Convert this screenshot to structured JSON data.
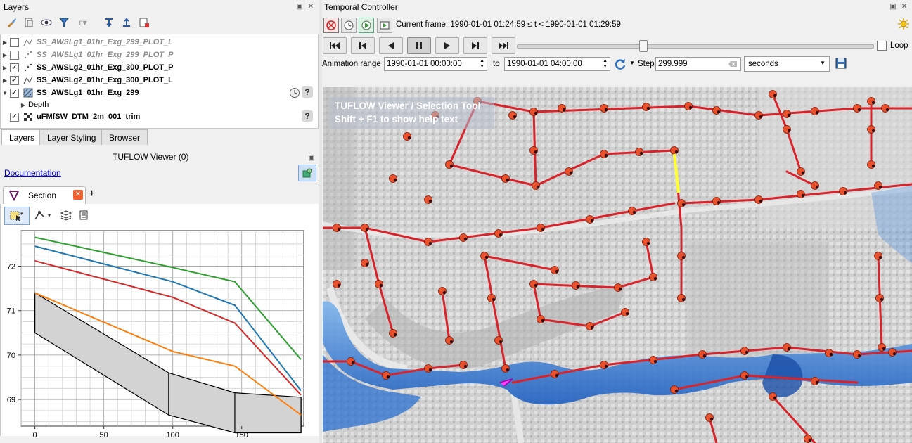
{
  "layers_panel": {
    "title": "Layers",
    "items": [
      {
        "name": "SS_AWSLg1_01hr_Exg_299_PLOT_L",
        "checked": false,
        "dim": true,
        "type": "line"
      },
      {
        "name": "SS_AWSLg1_01hr_Exg_299_PLOT_P",
        "checked": false,
        "dim": true,
        "type": "point"
      },
      {
        "name": "SS_AWSLg2_01hr_Exg_300_PLOT_P",
        "checked": true,
        "dim": false,
        "type": "point"
      },
      {
        "name": "SS_AWSLg2_01hr_Exg_300_PLOT_L",
        "checked": true,
        "dim": false,
        "type": "line"
      },
      {
        "name": "SS_AWSLg1_01hr_Exg_299",
        "checked": true,
        "dim": false,
        "type": "mesh"
      },
      {
        "name": "uFMfSW_DTM_2m_001_trim",
        "checked": true,
        "dim": false,
        "type": "raster"
      }
    ],
    "sub_item": "Depth",
    "tabs": [
      "Layers",
      "Layer Styling",
      "Browser"
    ]
  },
  "tuflow_panel": {
    "title": "TUFLOW Viewer (0)",
    "documentation_link": "Documentation",
    "section_tab": "Section",
    "add_tab": "+"
  },
  "section_chart": {
    "y_ticks": [
      "72",
      "71",
      "70",
      "69"
    ],
    "x_ticks": [
      "0",
      "50",
      "100",
      "150"
    ]
  },
  "chart_data": {
    "type": "line",
    "xlabel": "",
    "ylabel": "",
    "xlim": [
      -10,
      195
    ],
    "ylim": [
      68.4,
      72.8
    ],
    "series": [
      {
        "color": "#2ca02c",
        "x": [
          0,
          100,
          145,
          193
        ],
        "y": [
          72.65,
          71.97,
          71.65,
          69.9
        ]
      },
      {
        "color": "#1f77b4",
        "x": [
          0,
          100,
          145,
          193
        ],
        "y": [
          72.45,
          71.65,
          71.12,
          69.2
        ]
      },
      {
        "color": "#d62728",
        "x": [
          0,
          100,
          145,
          193
        ],
        "y": [
          72.12,
          71.3,
          70.72,
          69.1
        ]
      },
      {
        "color": "#ff7f0e",
        "x": [
          0,
          100,
          145,
          193
        ],
        "y": [
          71.4,
          70.08,
          69.75,
          68.65
        ]
      }
    ],
    "bed": {
      "top": {
        "x": [
          0,
          97,
          145,
          193
        ],
        "y": [
          71.4,
          69.6,
          69.15,
          69.05
        ]
      },
      "bottom": {
        "x": [
          0,
          97,
          145,
          193
        ],
        "y": [
          70.5,
          68.65,
          68.25,
          68.25
        ]
      },
      "fill": "#d3d3d3"
    },
    "grid": true
  },
  "temporal": {
    "title": "Temporal Controller",
    "current_frame": "Current frame: 1990-01-01 01:24:59 ≤ t < 1990-01-01 01:29:59",
    "loop_label": "Loop",
    "animation_range_label": "Animation range",
    "range_start": "1990-01-01 00:00:00",
    "to_label": "to",
    "range_end": "1990-01-01 04:00:00",
    "step_label": "Step",
    "step_value": "299.999",
    "step_unit": "seconds",
    "slider_fraction": 0.35
  },
  "map": {
    "overlay_line1": "TUFLOW Viewer / Selection Tool",
    "overlay_line2": "Shift + F1 to show help text"
  }
}
